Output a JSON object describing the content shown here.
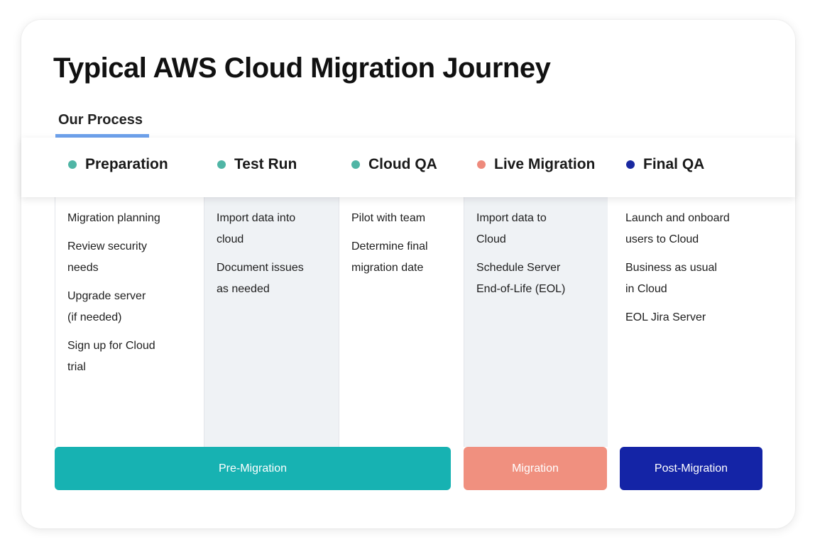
{
  "title": "Typical AWS Cloud Migration Journey",
  "tab": {
    "label": "Our Process"
  },
  "stages": [
    {
      "name": "Preparation",
      "dot_color": "#4fb5a5",
      "items": [
        "Migration planning",
        "Review security\nneeds",
        "Upgrade server\n(if needed)",
        "Sign up for Cloud\ntrial"
      ]
    },
    {
      "name": "Test Run",
      "dot_color": "#4fb5a5",
      "items": [
        "Import data into\ncloud",
        "Document issues\nas needed"
      ]
    },
    {
      "name": "Cloud QA",
      "dot_color": "#4fb5a5",
      "items": [
        "Pilot with team",
        "Determine final\nmigration date"
      ]
    },
    {
      "name": "Live Migration",
      "dot_color": "#ee8a7c",
      "items": [
        "Import data to\nCloud",
        "Schedule Server\nEnd-of-Life (EOL)"
      ]
    },
    {
      "name": "Final QA",
      "dot_color": "#1928a0",
      "items": [
        "Launch and onboard\nusers to Cloud",
        "Business as usual\nin Cloud",
        "EOL Jira Server"
      ]
    }
  ],
  "phases": [
    {
      "label": "Pre-Migration",
      "color": "#17b2b2"
    },
    {
      "label": "Migration",
      "color": "#f0907f"
    },
    {
      "label": "Post-Migration",
      "color": "#1424a6"
    }
  ]
}
